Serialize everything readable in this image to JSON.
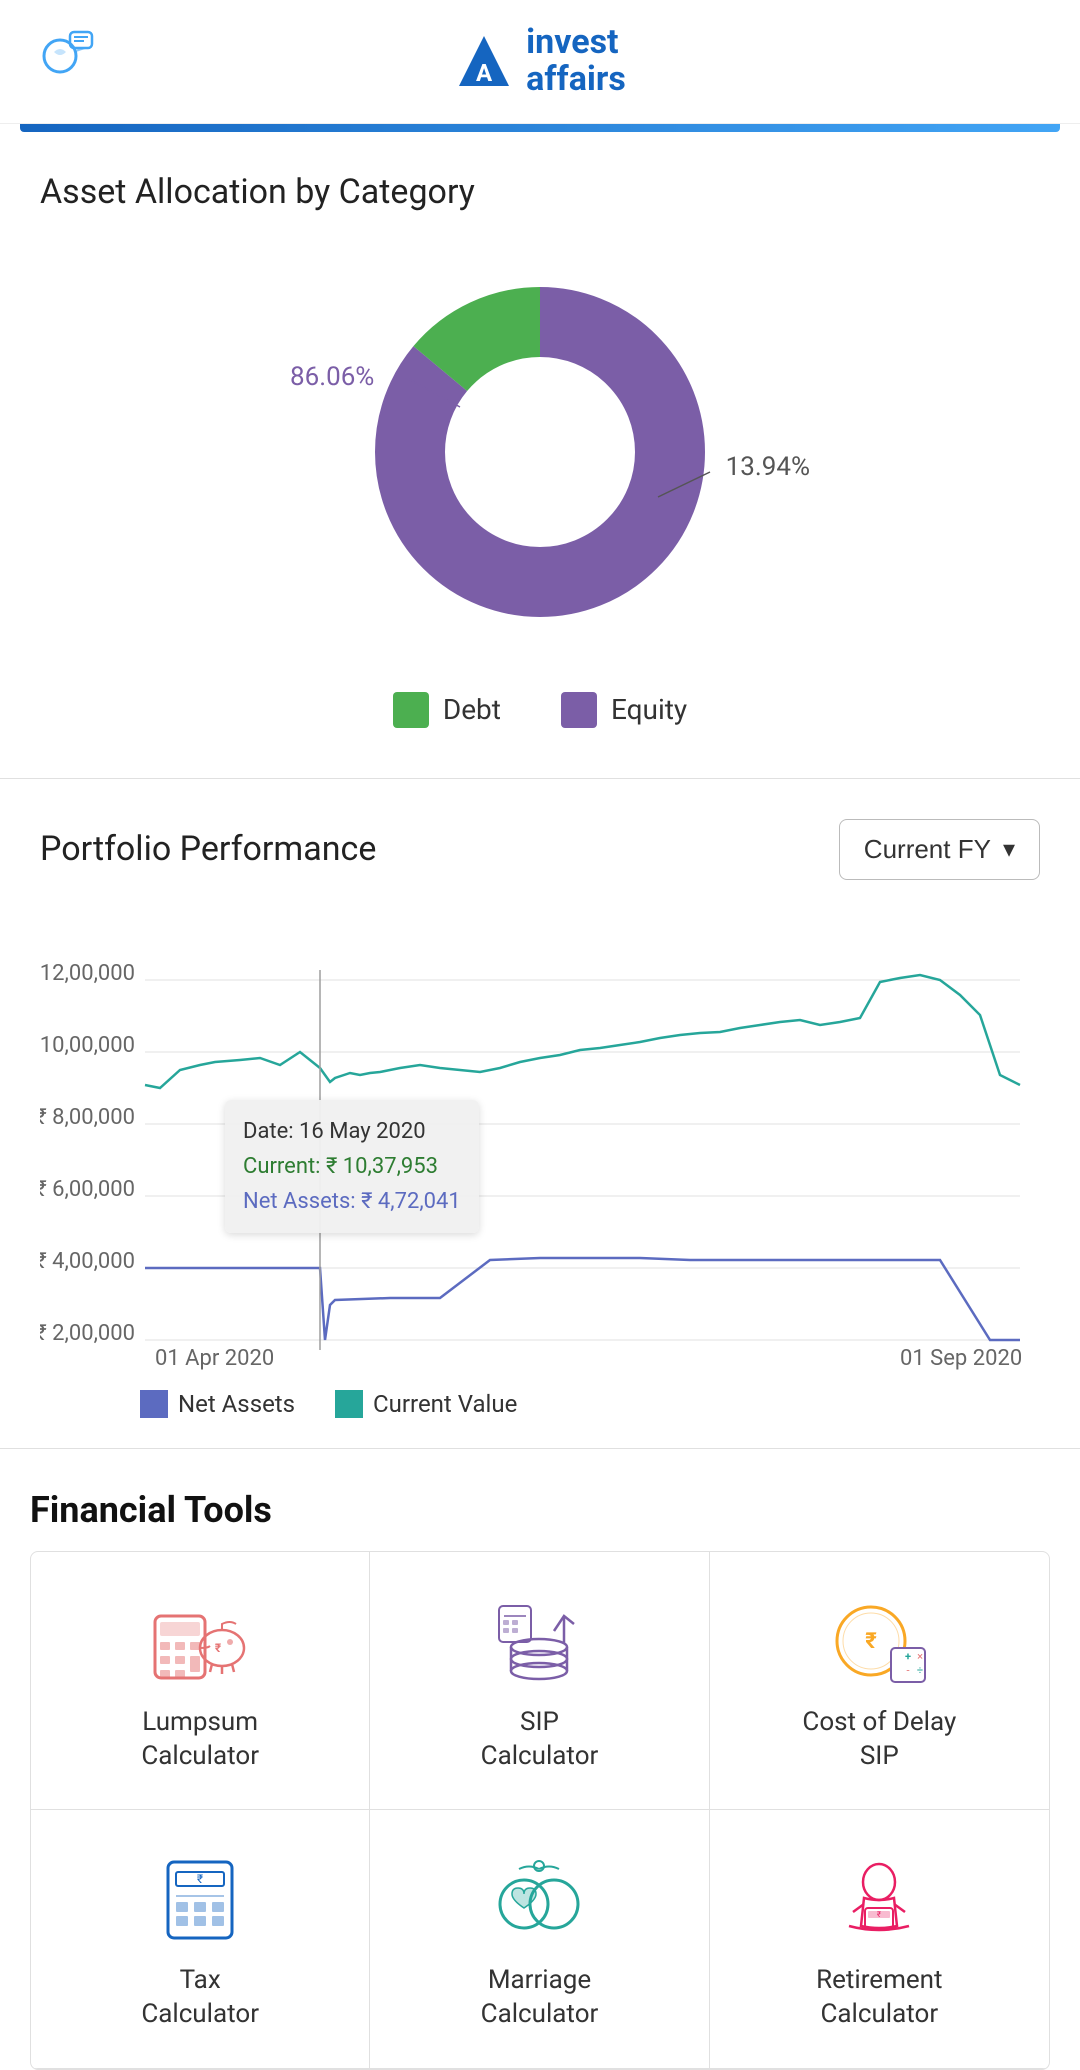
{
  "header": {
    "logo_invest": "invest",
    "logo_affairs": "affairs",
    "logo_registered": "©",
    "phone_icon": "phone-chat-icon"
  },
  "asset_allocation": {
    "title": "Asset Allocation by Category",
    "debt_percent": "86.06%",
    "equity_percent": "13.94%",
    "legend": {
      "debt_label": "Debt",
      "equity_label": "Equity",
      "debt_color": "#4caf50",
      "equity_color": "#7b5ea7"
    },
    "donut": {
      "debt_ratio": 0.8606,
      "equity_ratio": 0.1394,
      "debt_color": "#7b5ea7",
      "equity_color": "#4caf50"
    }
  },
  "portfolio_performance": {
    "title": "Portfolio Performance",
    "dropdown_label": "Current FY",
    "dropdown_icon": "chevron-down-icon",
    "y_axis_labels": [
      "₹ 2,00,000",
      "₹ 4,00,000",
      "₹ 6,00,000",
      "₹ 8,00,000",
      "₹ 10,00,000",
      "₹ 12,00,000"
    ],
    "x_axis_labels": [
      "01 Apr 2020",
      "01 Sep 2020"
    ],
    "tooltip": {
      "date": "Date: 16 May 2020",
      "current": "Current: ₹ 10,37,953",
      "net_assets": "Net Assets: ₹ 4,72,041"
    },
    "legend": {
      "net_assets_label": "Net Assets",
      "current_value_label": "Current Value",
      "net_assets_color": "#5c6bc0",
      "current_value_color": "#26a69a"
    }
  },
  "financial_tools": {
    "title": "Financial Tools",
    "tools": [
      {
        "id": "lumpsum-calculator",
        "label": "Lumpsum\nCalculator",
        "icon_color": "#e57373",
        "icon_type": "lumpsum"
      },
      {
        "id": "sip-calculator",
        "label": "SIP\nCalculator",
        "icon_color": "#7b5ea7",
        "icon_type": "sip"
      },
      {
        "id": "cost-of-delay-sip",
        "label": "Cost of Delay\nSIP",
        "icon_color": "#f9a825",
        "icon_type": "cost-delay"
      },
      {
        "id": "tax-calculator",
        "label": "Tax\nCalculator",
        "icon_color": "#1565c0",
        "icon_type": "tax"
      },
      {
        "id": "marriage-calculator",
        "label": "Marriage\nCalculator",
        "icon_color": "#26a69a",
        "icon_type": "marriage"
      },
      {
        "id": "retirement-calculator",
        "label": "Retirement\nCalculator",
        "icon_color": "#e91e63",
        "icon_type": "retirement"
      }
    ]
  }
}
